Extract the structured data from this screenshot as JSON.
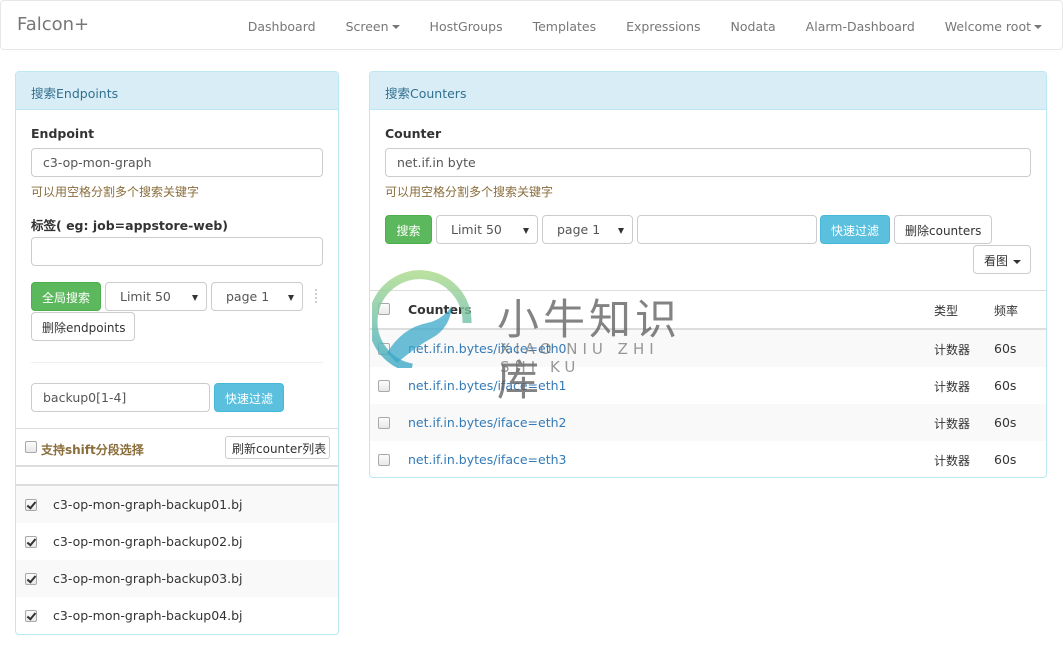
{
  "navbar": {
    "brand": "Falcon+",
    "items": [
      {
        "label": "Dashboard",
        "dropdown": false
      },
      {
        "label": "Screen",
        "dropdown": true
      },
      {
        "label": "HostGroups",
        "dropdown": false
      },
      {
        "label": "Templates",
        "dropdown": false
      },
      {
        "label": "Expressions",
        "dropdown": false
      },
      {
        "label": "Nodata",
        "dropdown": false
      },
      {
        "label": "Alarm-Dashboard",
        "dropdown": false
      },
      {
        "label": "Welcome root",
        "dropdown": true
      }
    ]
  },
  "endpoints_panel": {
    "title": "搜索Endpoints",
    "endpoint_label": "Endpoint",
    "endpoint_value": "c3-op-mon-graph",
    "help_text": "可以用空格分割多个搜索关键字",
    "tag_label": "标签( eg: job=appstore-web)",
    "tag_value": "",
    "global_search_button": "全局搜索",
    "limit_select": "Limit 50",
    "page_select": "page 1",
    "delete_button": "删除endpoints",
    "filter_value": "backup0[1-4]",
    "filter_button": "快速过滤",
    "shift_select_label": "支持shift分段选择",
    "shift_select_checked": false,
    "refresh_button": "刷新counter列表",
    "endpoints": [
      {
        "name": "c3-op-mon-graph-backup01.bj",
        "checked": true
      },
      {
        "name": "c3-op-mon-graph-backup02.bj",
        "checked": true
      },
      {
        "name": "c3-op-mon-graph-backup03.bj",
        "checked": true
      },
      {
        "name": "c3-op-mon-graph-backup04.bj",
        "checked": true
      }
    ]
  },
  "counters_panel": {
    "title": "搜索Counters",
    "counter_label": "Counter",
    "counter_value": "net.if.in byte",
    "help_text": "可以用空格分割多个搜索关键字",
    "search_button": "搜索",
    "limit_select": "Limit 50",
    "page_select": "page 1",
    "filter_value": "",
    "filter_button": "快速过滤",
    "delete_button": "删除counters",
    "view_graph_button": "看图",
    "table": {
      "columns": [
        "Counters",
        "类型",
        "频率"
      ],
      "rows": [
        {
          "counter": "net.if.in.bytes/iface=eth0",
          "type": "计数器",
          "freq": "60s",
          "checked": false
        },
        {
          "counter": "net.if.in.bytes/iface=eth1",
          "type": "计数器",
          "freq": "60s",
          "checked": false
        },
        {
          "counter": "net.if.in.bytes/iface=eth2",
          "type": "计数器",
          "freq": "60s",
          "checked": false
        },
        {
          "counter": "net.if.in.bytes/iface=eth3",
          "type": "计数器",
          "freq": "60s",
          "checked": false
        }
      ]
    }
  },
  "watermark": {
    "title": "小牛知识库",
    "subtitle": "XIAO NIU ZHI SHI KU"
  },
  "colors": {
    "success": "#5cb85c",
    "info": "#5bc0de",
    "panel_heading": "#d9edf7",
    "link": "#337ab7"
  }
}
